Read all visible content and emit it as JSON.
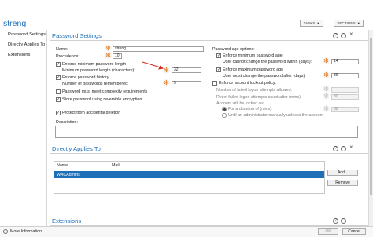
{
  "window": {
    "title": "streng",
    "tasks_label": "TASKS",
    "sections_label": "SECTIONS"
  },
  "nav": {
    "items": [
      "Password Settings",
      "Directly Applies To",
      "Extensions"
    ]
  },
  "password_settings": {
    "title": "Password Settings",
    "name_label": "Name:",
    "name_value": "streng",
    "precedence_label": "Precedence:",
    "precedence_value": "10",
    "enforce_min_length_label": "Enforce minimum password length",
    "min_length_label": "Minimum password length (characters):",
    "min_length_value": "32",
    "enforce_history_label": "Enforce password history",
    "history_label": "Number of passwords remembered:",
    "history_value": "5",
    "complexity_label": "Password must meet complexity requirements",
    "reversible_label": "Store password using reversible encryption",
    "protect_label": "Protect from accidental deletion",
    "description_label": "Description:",
    "age_options_label": "Password age options:",
    "enforce_min_age_label": "Enforce minimum password age",
    "min_age_label": "User cannot change the password within (days):",
    "min_age_value": "14",
    "enforce_max_age_label": "Enforce maximum password age",
    "max_age_label": "User must change the password after (days):",
    "max_age_value": "36",
    "lockout_label": "Enforce account lockout policy:",
    "failed_attempts_label": "Number of failed logon attempts allowed:",
    "reset_label": "Reset failed logon attempts count after (mins):",
    "reset_value": "30",
    "locked_out_label": "Account will be locked out",
    "duration_label": "For a duration of (mins):",
    "duration_value": "30",
    "until_admin_label": "Until an administrator manually unlocks the account"
  },
  "applies_to": {
    "title": "Directly Applies To",
    "col_name": "Name",
    "col_mail": "Mail",
    "rows": [
      {
        "name": "WACAdmins",
        "mail": ""
      }
    ],
    "add_label": "Add...",
    "remove_label": "Remove"
  },
  "extensions": {
    "title": "Extensions"
  },
  "footer": {
    "more_info": "More Information",
    "ok_label": "OK",
    "cancel_label": "Cancel"
  },
  "colors": {
    "accent": "#1f6fb8",
    "selection": "#1f6fb8",
    "arrow": "#d62a1e",
    "asterisk": "#e07a20"
  }
}
